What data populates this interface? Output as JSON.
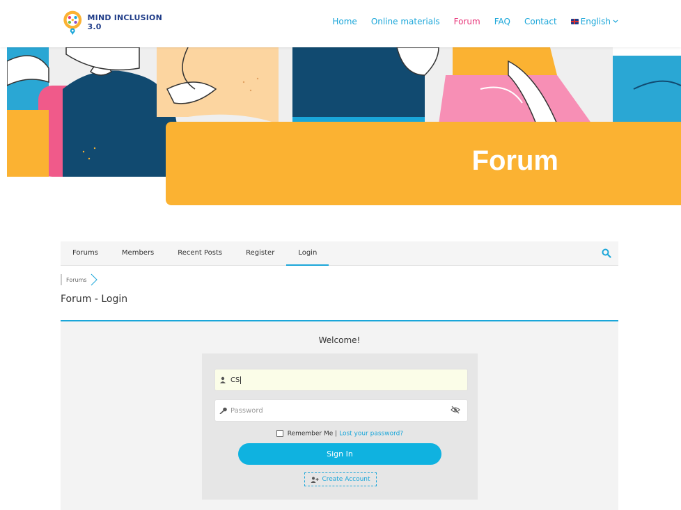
{
  "header": {
    "logo_text": "MIND INCLUSION 3.0",
    "nav": [
      "Home",
      "Online materials",
      "Forum",
      "FAQ",
      "Contact"
    ],
    "language": "English"
  },
  "hero": {
    "title": "Forum"
  },
  "forum_nav": {
    "tabs": [
      "Forums",
      "Members",
      "Recent Posts",
      "Register",
      "Login"
    ]
  },
  "breadcrumb": {
    "item": "Forums"
  },
  "page_title": "Forum - Login",
  "login": {
    "welcome": "Welcome!",
    "username_value": "CS",
    "password_placeholder": "Password",
    "remember_label": "Remember Me",
    "separator": "|",
    "lost_password": "Lost your password?",
    "signin_label": "Sign In",
    "create_account": "Create Account"
  },
  "colors": {
    "accent": "#1aa6d9",
    "active_nav": "#e8367a",
    "banner": "#fbb232",
    "button": "#0fb2e0"
  },
  "icons": [
    "logo-icon",
    "flag-icon",
    "chevron-down-icon",
    "search-icon",
    "user-icon",
    "key-icon",
    "eye-off-icon",
    "add-user-icon",
    "chevron-right-icon"
  ]
}
